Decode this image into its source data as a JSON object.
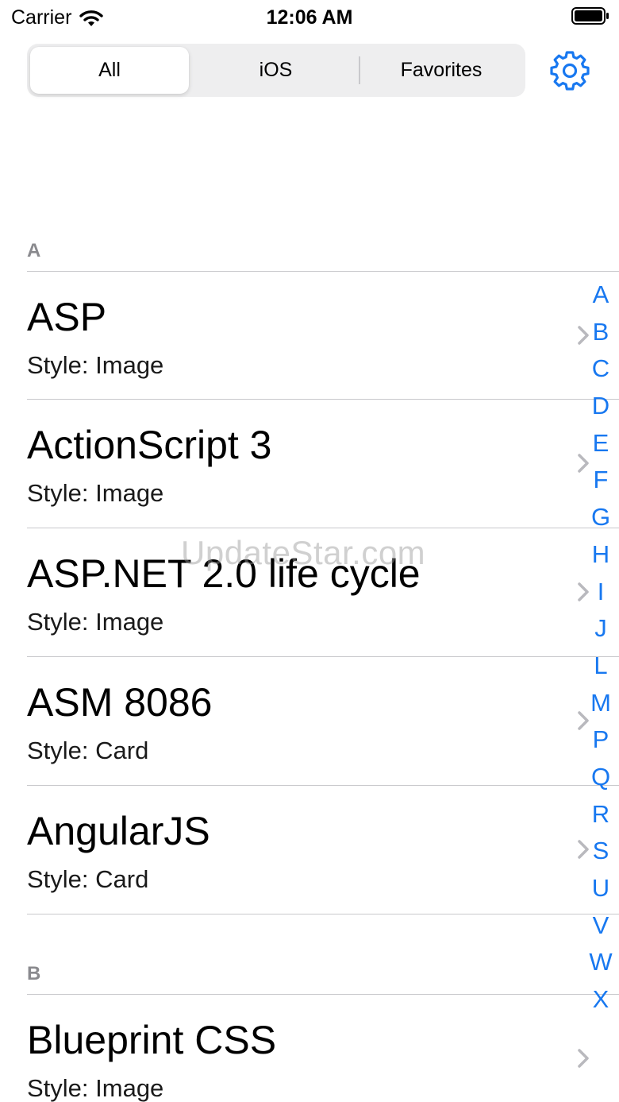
{
  "status_bar": {
    "carrier": "Carrier",
    "time": "12:06 AM"
  },
  "segmented": {
    "all": "All",
    "ios": "iOS",
    "favorites": "Favorites"
  },
  "sections": {
    "a": {
      "header": "A",
      "rows": [
        {
          "title": "ASP",
          "subtitle": "Style: Image"
        },
        {
          "title": "ActionScript 3",
          "subtitle": "Style: Image"
        },
        {
          "title": "ASP.NET 2.0 life cycle",
          "subtitle": "Style: Image"
        },
        {
          "title": "ASM 8086",
          "subtitle": "Style: Card"
        },
        {
          "title": "AngularJS",
          "subtitle": "Style: Card"
        }
      ]
    },
    "b": {
      "header": "B",
      "rows": [
        {
          "title": "Blueprint CSS",
          "subtitle": "Style: Image"
        }
      ]
    }
  },
  "index": [
    "A",
    "B",
    "C",
    "D",
    "E",
    "F",
    "G",
    "H",
    "I",
    "J",
    "L",
    "M",
    "P",
    "Q",
    "R",
    "S",
    "U",
    "V",
    "W",
    "X"
  ],
  "watermark": "UpdateStar.com",
  "colors": {
    "accent": "#1878f0",
    "header": "#8a8a8e"
  }
}
